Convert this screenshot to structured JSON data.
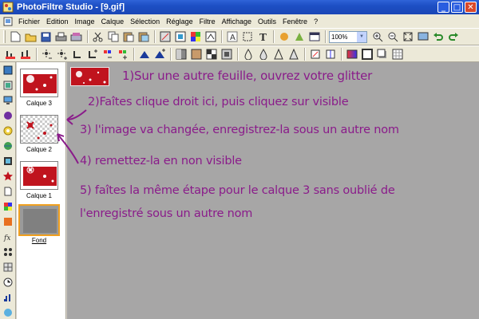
{
  "window": {
    "title": "PhotoFiltre Studio - [9.gif]",
    "minimize": "_",
    "maximize": "□",
    "close": "✕"
  },
  "menubar": {
    "items": [
      "Fichier",
      "Edition",
      "Image",
      "Calque",
      "Sélection",
      "Réglage",
      "Filtre",
      "Affichage",
      "Outils",
      "Fenêtre",
      "?"
    ]
  },
  "toolbar": {
    "zoom_value": "100%"
  },
  "layers": [
    {
      "label": "Calque 3"
    },
    {
      "label": "Calque 2"
    },
    {
      "label": "Calque 1"
    },
    {
      "label": "Fond"
    }
  ],
  "instructions": {
    "step1": "1)Sur une autre feuille, ouvrez votre glitter",
    "step2": "2)Faîtes clique droit ici, puis cliquez sur visible",
    "step3": "3) l'image va changée, enregistrez-la sous un autre nom",
    "step4": "4) remettez-la en non visible",
    "step5a": "5) faîtes la même étape pour le calque 3 sans oublié de",
    "step5b": "l'enregistré sous un autre nom"
  },
  "colors": {
    "accent": "#8a1b8a",
    "titlebar": "#1d4fc4",
    "workspace": "#a7a6a6",
    "glitter_red": "#c0141e"
  }
}
